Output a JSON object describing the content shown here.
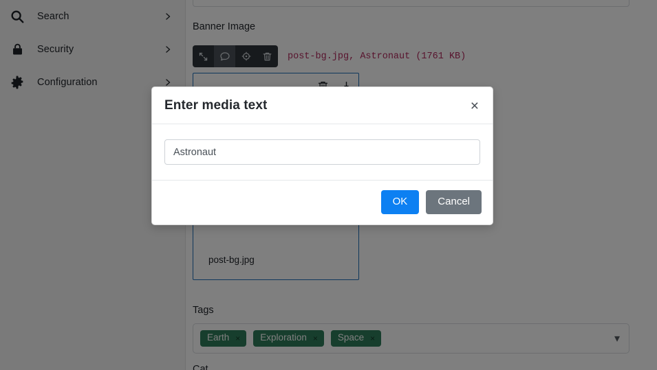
{
  "sidebar": {
    "items": [
      {
        "label": "Search",
        "icon": "search-icon",
        "chevron": "›"
      },
      {
        "label": "Security",
        "icon": "lock-icon",
        "chevron": "›"
      },
      {
        "label": "Configuration",
        "icon": "gear-icon",
        "chevron": "›"
      }
    ]
  },
  "main": {
    "banner_label": "Banner Image",
    "media_toolbar": {
      "buttons": [
        {
          "name": "resize-icon",
          "active": false
        },
        {
          "name": "comment-icon",
          "active": true
        },
        {
          "name": "crosshair-icon",
          "active": false
        },
        {
          "name": "trash-icon",
          "active": false
        }
      ]
    },
    "media_file_info": "post-bg.jpg, Astronaut (1761 KB)",
    "dropzone": {
      "filename": "post-bg.jpg",
      "actions": [
        {
          "name": "delete-file-icon"
        },
        {
          "name": "download-file-icon"
        }
      ]
    },
    "tags_label": "Tags",
    "tags": [
      {
        "label": "Earth",
        "remove": "×"
      },
      {
        "label": "Exploration",
        "remove": "×"
      },
      {
        "label": "Space",
        "remove": "×"
      }
    ],
    "tags_caret": "▾",
    "cut_label": "Cat."
  },
  "modal": {
    "title": "Enter media text",
    "close": "×",
    "input_value": "Astronaut",
    "input_placeholder": "",
    "ok_label": "OK",
    "cancel_label": "Cancel"
  },
  "colors": {
    "accent_blue": "#0d80f2",
    "cancel_gray": "#6c757d",
    "tag_green": "#2f7d5a",
    "file_info_red": "#b0275b",
    "dropzone_border": "#1f6fb8",
    "toolbar_dark": "#2f343a"
  }
}
